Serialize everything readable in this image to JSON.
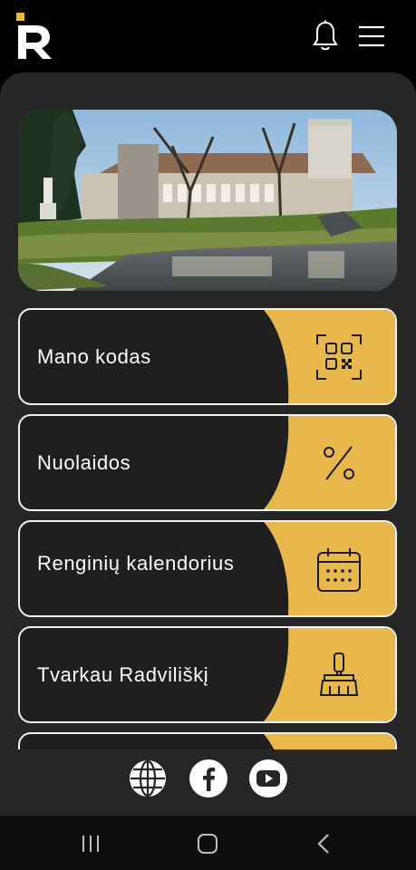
{
  "header": {
    "logo_icon": "brand-r-logo",
    "notifications_icon": "bell-icon",
    "menu_icon": "hamburger-menu-icon"
  },
  "hero": {
    "image": "manor-estate-photo"
  },
  "menu_cards": [
    {
      "label": "Mano kodas",
      "icon": "qr-code-icon"
    },
    {
      "label": "Nuolaidos",
      "icon": "percent-icon"
    },
    {
      "label": "Renginių kalendorius",
      "icon": "calendar-icon"
    },
    {
      "label": "Tvarkau Radviliškį",
      "icon": "broom-icon"
    }
  ],
  "social": [
    {
      "icon": "globe-icon"
    },
    {
      "icon": "facebook-icon"
    },
    {
      "icon": "youtube-icon"
    }
  ],
  "system_nav": {
    "icons": [
      "recent-apps-icon",
      "home-icon",
      "back-icon"
    ]
  },
  "colors": {
    "accent": "#e8b84d",
    "panel": "#262626",
    "background": "#000000"
  }
}
